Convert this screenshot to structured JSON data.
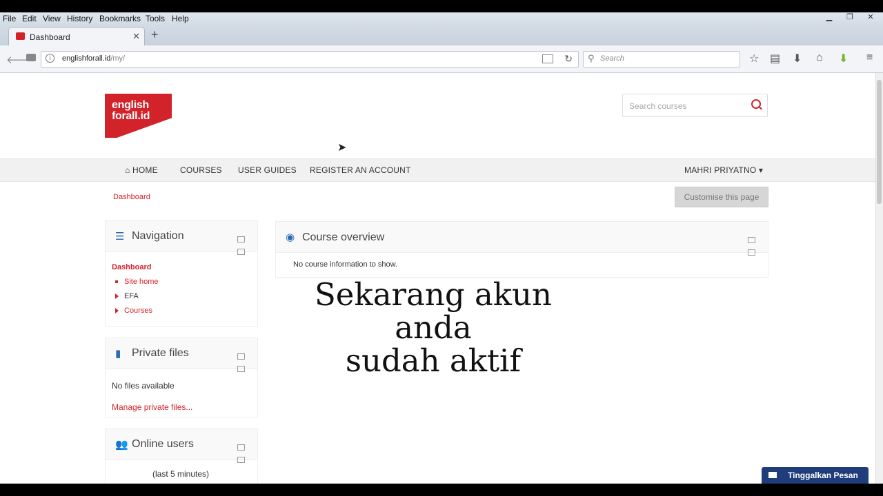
{
  "browser": {
    "menu": [
      "File",
      "Edit",
      "View",
      "History",
      "Bookmarks",
      "Tools",
      "Help"
    ],
    "tab_title": "Dashboard",
    "url_domain": "englishforall.id",
    "url_path": "/my/",
    "search_placeholder": "Search"
  },
  "site": {
    "logo_line1": "english",
    "logo_line2": "forall.id",
    "course_search_placeholder": "Search courses",
    "nav": {
      "home": "HOME",
      "courses": "COURSES",
      "user_guides": "USER GUIDES",
      "register": "REGISTER AN ACCOUNT",
      "user": "MAHRI PRIYATNO"
    },
    "breadcrumb": "Dashboard",
    "customise_button": "Customise this page",
    "navigation_block": {
      "title": "Navigation",
      "current": "Dashboard",
      "items": [
        "Site home",
        "EFA",
        "Courses"
      ]
    },
    "private_files_block": {
      "title": "Private files",
      "empty_text": "No files available",
      "manage_link": "Manage private files..."
    },
    "online_users_block": {
      "title": "Online users",
      "subtitle": "(last 5 minutes)"
    },
    "course_overview": {
      "title": "Course overview",
      "empty_text": "No course information to show."
    },
    "overlay_caption_line1": "Sekarang akun anda",
    "overlay_caption_line2": "sudah aktif",
    "chat_button": "Tinggalkan Pesan"
  },
  "colors": {
    "accent": "#d2232a",
    "chat": "#1e3d7a"
  }
}
